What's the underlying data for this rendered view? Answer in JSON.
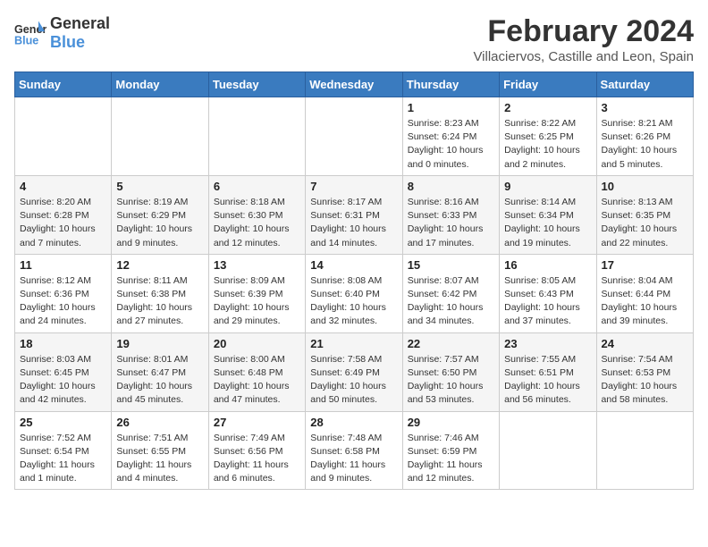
{
  "logo": {
    "line1": "General",
    "line2": "Blue"
  },
  "title": "February 2024",
  "subtitle": "Villaciervos, Castille and Leon, Spain",
  "header_days": [
    "Sunday",
    "Monday",
    "Tuesday",
    "Wednesday",
    "Thursday",
    "Friday",
    "Saturday"
  ],
  "weeks": [
    [
      {
        "day": "",
        "detail": ""
      },
      {
        "day": "",
        "detail": ""
      },
      {
        "day": "",
        "detail": ""
      },
      {
        "day": "",
        "detail": ""
      },
      {
        "day": "1",
        "detail": "Sunrise: 8:23 AM\nSunset: 6:24 PM\nDaylight: 10 hours\nand 0 minutes."
      },
      {
        "day": "2",
        "detail": "Sunrise: 8:22 AM\nSunset: 6:25 PM\nDaylight: 10 hours\nand 2 minutes."
      },
      {
        "day": "3",
        "detail": "Sunrise: 8:21 AM\nSunset: 6:26 PM\nDaylight: 10 hours\nand 5 minutes."
      }
    ],
    [
      {
        "day": "4",
        "detail": "Sunrise: 8:20 AM\nSunset: 6:28 PM\nDaylight: 10 hours\nand 7 minutes."
      },
      {
        "day": "5",
        "detail": "Sunrise: 8:19 AM\nSunset: 6:29 PM\nDaylight: 10 hours\nand 9 minutes."
      },
      {
        "day": "6",
        "detail": "Sunrise: 8:18 AM\nSunset: 6:30 PM\nDaylight: 10 hours\nand 12 minutes."
      },
      {
        "day": "7",
        "detail": "Sunrise: 8:17 AM\nSunset: 6:31 PM\nDaylight: 10 hours\nand 14 minutes."
      },
      {
        "day": "8",
        "detail": "Sunrise: 8:16 AM\nSunset: 6:33 PM\nDaylight: 10 hours\nand 17 minutes."
      },
      {
        "day": "9",
        "detail": "Sunrise: 8:14 AM\nSunset: 6:34 PM\nDaylight: 10 hours\nand 19 minutes."
      },
      {
        "day": "10",
        "detail": "Sunrise: 8:13 AM\nSunset: 6:35 PM\nDaylight: 10 hours\nand 22 minutes."
      }
    ],
    [
      {
        "day": "11",
        "detail": "Sunrise: 8:12 AM\nSunset: 6:36 PM\nDaylight: 10 hours\nand 24 minutes."
      },
      {
        "day": "12",
        "detail": "Sunrise: 8:11 AM\nSunset: 6:38 PM\nDaylight: 10 hours\nand 27 minutes."
      },
      {
        "day": "13",
        "detail": "Sunrise: 8:09 AM\nSunset: 6:39 PM\nDaylight: 10 hours\nand 29 minutes."
      },
      {
        "day": "14",
        "detail": "Sunrise: 8:08 AM\nSunset: 6:40 PM\nDaylight: 10 hours\nand 32 minutes."
      },
      {
        "day": "15",
        "detail": "Sunrise: 8:07 AM\nSunset: 6:42 PM\nDaylight: 10 hours\nand 34 minutes."
      },
      {
        "day": "16",
        "detail": "Sunrise: 8:05 AM\nSunset: 6:43 PM\nDaylight: 10 hours\nand 37 minutes."
      },
      {
        "day": "17",
        "detail": "Sunrise: 8:04 AM\nSunset: 6:44 PM\nDaylight: 10 hours\nand 39 minutes."
      }
    ],
    [
      {
        "day": "18",
        "detail": "Sunrise: 8:03 AM\nSunset: 6:45 PM\nDaylight: 10 hours\nand 42 minutes."
      },
      {
        "day": "19",
        "detail": "Sunrise: 8:01 AM\nSunset: 6:47 PM\nDaylight: 10 hours\nand 45 minutes."
      },
      {
        "day": "20",
        "detail": "Sunrise: 8:00 AM\nSunset: 6:48 PM\nDaylight: 10 hours\nand 47 minutes."
      },
      {
        "day": "21",
        "detail": "Sunrise: 7:58 AM\nSunset: 6:49 PM\nDaylight: 10 hours\nand 50 minutes."
      },
      {
        "day": "22",
        "detail": "Sunrise: 7:57 AM\nSunset: 6:50 PM\nDaylight: 10 hours\nand 53 minutes."
      },
      {
        "day": "23",
        "detail": "Sunrise: 7:55 AM\nSunset: 6:51 PM\nDaylight: 10 hours\nand 56 minutes."
      },
      {
        "day": "24",
        "detail": "Sunrise: 7:54 AM\nSunset: 6:53 PM\nDaylight: 10 hours\nand 58 minutes."
      }
    ],
    [
      {
        "day": "25",
        "detail": "Sunrise: 7:52 AM\nSunset: 6:54 PM\nDaylight: 11 hours\nand 1 minute."
      },
      {
        "day": "26",
        "detail": "Sunrise: 7:51 AM\nSunset: 6:55 PM\nDaylight: 11 hours\nand 4 minutes."
      },
      {
        "day": "27",
        "detail": "Sunrise: 7:49 AM\nSunset: 6:56 PM\nDaylight: 11 hours\nand 6 minutes."
      },
      {
        "day": "28",
        "detail": "Sunrise: 7:48 AM\nSunset: 6:58 PM\nDaylight: 11 hours\nand 9 minutes."
      },
      {
        "day": "29",
        "detail": "Sunrise: 7:46 AM\nSunset: 6:59 PM\nDaylight: 11 hours\nand 12 minutes."
      },
      {
        "day": "",
        "detail": ""
      },
      {
        "day": "",
        "detail": ""
      }
    ]
  ]
}
